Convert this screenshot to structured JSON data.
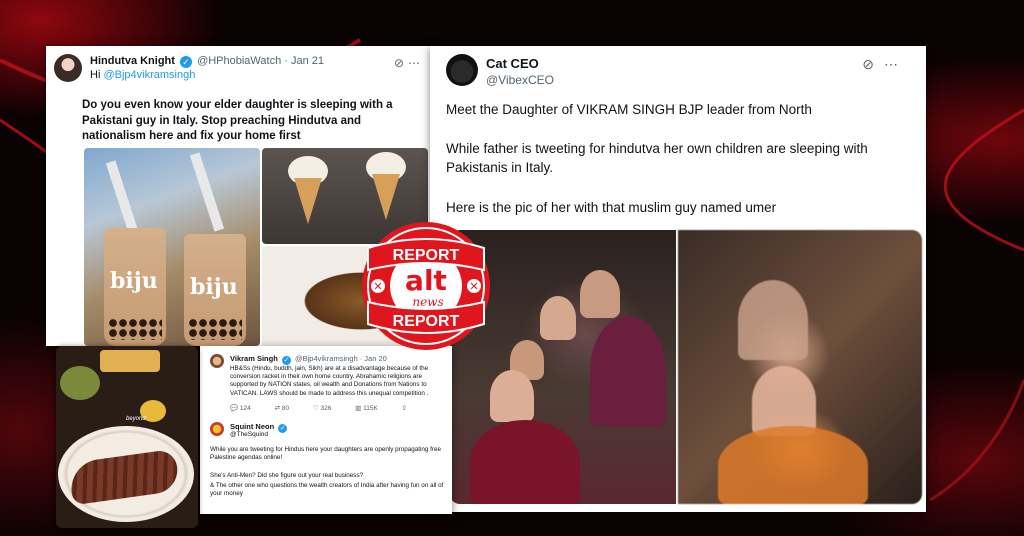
{
  "tweet1": {
    "name": "Hindutva Knight",
    "handle": "@HPhobiaWatch",
    "date": "· Jan 21",
    "reply_prefix": "Hi ",
    "mention": "@Bjp4vikramsingh",
    "text": "Do you even know your elder daughter is sleeping with a Pakistani guy in Italy. Stop preaching Hindutva and nationalism here and fix your home first",
    "cup_label_1": "biju",
    "cup_label_2": "biju"
  },
  "tweet2": {
    "name": "Cat CEO",
    "handle": "@VibexCEO",
    "line1": "Meet the Daughter of VIKRAM SINGH BJP leader from North",
    "line2": "While father is tweeting for hindutva her own children are sleeping with Pakistanis in Italy.",
    "line3": "Here is the pic of her with that muslim guy named umer"
  },
  "tweet3": {
    "name1": "Vikram Singh",
    "handle1": "@Bjp4vikramsingh · Jan 20",
    "text1": "HB&Ss (Hindu, buddh, jain, Sikh) are at a disadvantage because of the conversion racket in their own home country. Abrahamic religions are supported by NATION states, oil wealth and Donations from Nations to VATICAN. LAWS should be made to address this unequal competition .",
    "replies": "124",
    "retweets": "80",
    "likes": "326",
    "views": "115K",
    "name2": "Squint Neon",
    "handle2": "@TheSquind",
    "text2a": "While you are tweeting for Hindus here your daughters are openly propagating free Palestine agendas online!",
    "text2b": "She's Anti-Men? Did she figure out your real business?",
    "text2c": "& The other one who questions the wealth creators of India after having fun on all of your money"
  },
  "food_photo": {
    "caption": "beyond"
  },
  "logo": {
    "top": "REPORT",
    "bottom": "REPORT",
    "main": "alt",
    "sub": "news"
  },
  "colors": {
    "accent_red": "#e0161e",
    "twitter_blue": "#1d9bf0"
  }
}
